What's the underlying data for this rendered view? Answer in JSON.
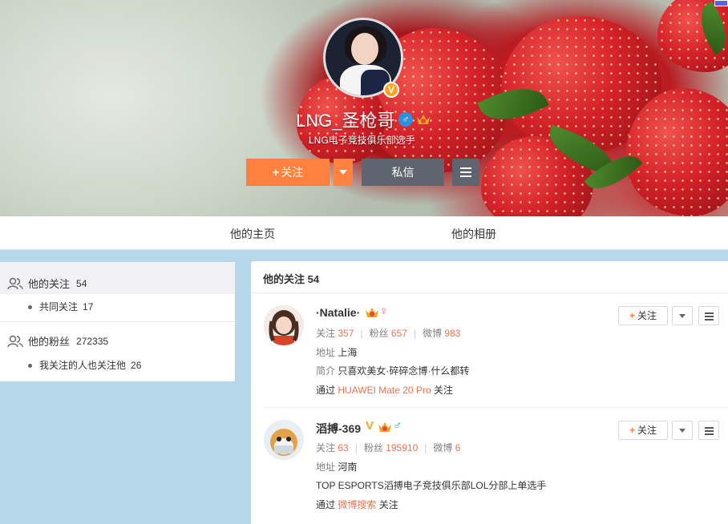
{
  "profile": {
    "nickname": "LNG_圣枪哥",
    "verified_badge": "V",
    "gender_symbol": "♂",
    "description": "LNG电子竞技俱乐部选手",
    "follow_button": "关注",
    "follow_plus": "+",
    "message_button": "私信"
  },
  "tabs": [
    {
      "label": "他的主页"
    },
    {
      "label": "他的相册"
    }
  ],
  "sidebar": {
    "following_label": "他的关注",
    "following_count": "54",
    "mutual_label": "共同关注",
    "mutual_count": "17",
    "fans_label": "他的粉丝",
    "fans_count": "272335",
    "fans_followed_label": "我关注的人也关注他",
    "fans_followed_count": "26"
  },
  "main": {
    "title": "他的关注 54",
    "users": [
      {
        "name": "·Natalie·",
        "gender_symbol": "♀",
        "follow_label": "关注",
        "following_label": "关注",
        "following": "357",
        "fans_label": "粉丝",
        "fans": "657",
        "weibo_label": "微博",
        "weibo": "983",
        "address_label": "地址",
        "address": "上海",
        "intro_label": "简介",
        "intro": "只喜欢美女·碎碎念博·什么都转",
        "via_label": "通过",
        "via": "HUAWEI Mate 20 Pro",
        "via_suffix": "关注"
      },
      {
        "name": "滔搏-369",
        "verified_badge": "V",
        "gender_symbol": "♂",
        "follow_label": "关注",
        "following_label": "关注",
        "following": "63",
        "fans_label": "粉丝",
        "fans": "195910",
        "weibo_label": "微博",
        "weibo": "6",
        "address_label": "地址",
        "address": "河南",
        "intro": "TOP ESPORTS滔搏电子竞技俱乐部LOL分部上单选手",
        "via_label": "通过",
        "via": "微博搜索",
        "via_suffix": "关注"
      }
    ]
  },
  "colors": {
    "accent_orange": "#ff8140",
    "link_orange": "#eb7350",
    "button_gray": "#5f6570",
    "page_bg": "#b7d7ea"
  }
}
